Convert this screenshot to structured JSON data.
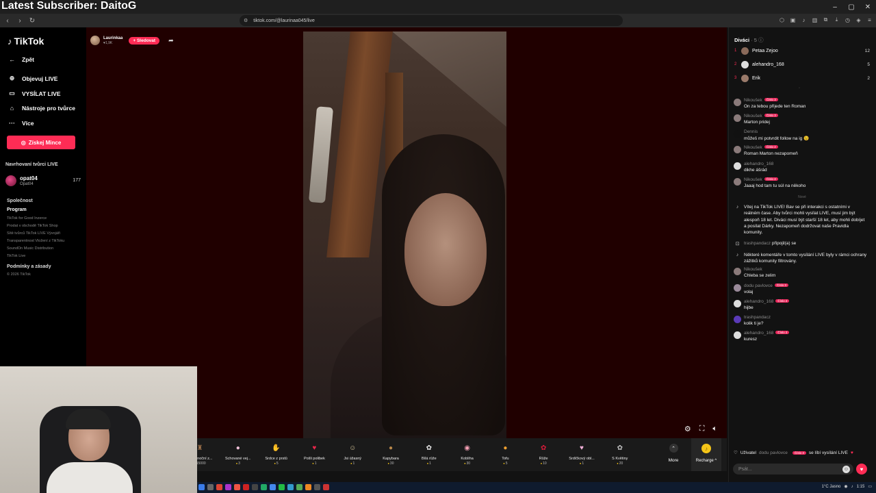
{
  "overlay": {
    "text": "Latest Subscriber: DaitoG"
  },
  "browser": {
    "url": "tiktok.com/@laurinaa045/live",
    "window_controls": [
      "–",
      "▢",
      "✕"
    ]
  },
  "sidebar": {
    "logo": "TikTok",
    "nav": [
      {
        "label": "Zpět",
        "icon": "arrow-left-icon",
        "glyph": "←"
      },
      {
        "label": "Objevuj LIVE",
        "icon": "compass-icon",
        "glyph": "⊕"
      },
      {
        "label": "VYSÍLAT LIVE",
        "icon": "camera-icon",
        "glyph": "▭"
      },
      {
        "label": "Nástroje pro tvůrce",
        "icon": "home-icon",
        "glyph": "⌂"
      },
      {
        "label": "Více",
        "icon": "more-icon",
        "glyph": "···"
      }
    ],
    "coins_button": "Získej Mince",
    "suggested_title": "Navrhovaní tvůrci LIVE",
    "suggested_creator": {
      "name": "opat04",
      "sub": "Opat04",
      "count": "177"
    },
    "company_title": "Společnost",
    "program_title": "Program",
    "links": [
      "TikTok for Good  Inzerce",
      "Prodat v obchodě TikTok Shop",
      "Sítě tvůrců TikTok LIVE  Vývojáři",
      "Transparentnost  Vložení z TikToku",
      "SoundOn Music Distribution",
      "TikTok Live"
    ],
    "terms_title": "Podmínky a zásady",
    "copyright": "© 2026 TikTok"
  },
  "stream": {
    "host_name": "Laurinkaa",
    "host_likes": "♥1,9K",
    "follow_label": "+ Sledovat"
  },
  "gifts": [
    {
      "name": "Velikonoční z...",
      "price": "15000",
      "glyph": "♜",
      "color": "#a0724a"
    },
    {
      "name": "Schované vej...",
      "price": "3",
      "glyph": "●",
      "color": "#f0c0d8"
    },
    {
      "name": "Srdce z prstů",
      "price": "5",
      "glyph": "✋",
      "color": "#f29a9a"
    },
    {
      "name": "Pošli polibek",
      "price": "1",
      "glyph": "♥",
      "color": "#e8264a"
    },
    {
      "name": "Jsi úžasný",
      "price": "1",
      "glyph": "☺",
      "color": "#d9c89a"
    },
    {
      "name": "Kapybara",
      "price": "30",
      "glyph": "●",
      "color": "#b8874a"
    },
    {
      "name": "Bílá růže",
      "price": "1",
      "glyph": "✿",
      "color": "#e8e8e8"
    },
    {
      "name": "Kobliha",
      "price": "30",
      "glyph": "◉",
      "color": "#f5a0b5"
    },
    {
      "name": "Tofu",
      "price": "5",
      "glyph": "●",
      "color": "#f0a030"
    },
    {
      "name": "Růže",
      "price": "10",
      "glyph": "✿",
      "color": "#d81b3a"
    },
    {
      "name": "Srdíčkový obl...",
      "price": "1",
      "glyph": "♥",
      "color": "#f0b0d8"
    },
    {
      "name": "S Květiny",
      "price": "20",
      "glyph": "✿",
      "color": "#c0c0c0"
    }
  ],
  "more_label": "More",
  "recharge_label": "Recharge ^",
  "chat": {
    "viewers_title": "Diváci",
    "viewers_count": "· 5",
    "top_viewers": [
      {
        "rank": "1",
        "name": "Petaa Zejoo",
        "score": "12",
        "color": "#8a6a5a"
      },
      {
        "rank": "2",
        "name": "alehandro_168",
        "score": "5",
        "color": "#dddddd"
      },
      {
        "rank": "3",
        "name": "Erik",
        "score": "2",
        "color": "#9a7a6a"
      }
    ],
    "messages": [
      {
        "user": "Nikoušek",
        "badge": "Číslo 3",
        "text": "On za tebou přijede ten Roman",
        "color": "#8a7a7a"
      },
      {
        "user": "Nikoušek",
        "badge": "Číslo 3",
        "text": "Marton pridej",
        "color": "#8a7a7a"
      },
      {
        "user": "Dennis",
        "badge": "",
        "text": "můžeš mi potvrdit follow na ig 😉",
        "color": "#111111"
      },
      {
        "user": "Nikoušek",
        "badge": "Číslo 2",
        "text": "Roman Marton nezapomeň",
        "color": "#8a7a7a"
      },
      {
        "user": "alehandro_168",
        "badge": "",
        "text": "dikhe ášrád",
        "color": "#dddddd"
      },
      {
        "user": "Nikoušek",
        "badge": "Číslo 2",
        "text": "Jaaaj hod tam tu súl na někoho",
        "color": "#8a7a7a"
      }
    ],
    "new_label": "Nové",
    "welcome": "Vítej na TikTok LIVE! Bav se při interakci s ostatními v reálném čase. Aby tvůrci mohli vysílat LIVE, musí jim být alespoň 18 let. Diváci musí být starší 18 let, aby mohli dobíjet a posílat Dárky. Nezapomeň dodržovat naše Pravidla komunity.",
    "joined_user": "trashpandacz",
    "joined_text": "připojil(a) se",
    "filter_note": "Některé komentáře v tomto vysílání LIVE byly v rámci ochrany zážitků komunity filtrovány.",
    "messages2": [
      {
        "user": "Nikoušek",
        "badge": "",
        "text": "Chleba se zelim",
        "color": "#8a7a7a"
      },
      {
        "user": "dodu pavlovce",
        "badge": "Číslo 3",
        "text": "volaj",
        "color": "#9a8a9a"
      },
      {
        "user": "alehandro_168",
        "badge": "Číslo 2",
        "text": "hijbe",
        "color": "#dddddd"
      },
      {
        "user": "trashpandacz",
        "badge": "",
        "text": "kolik ti je?",
        "color": "#5a3ab8"
      },
      {
        "user": "alehandro_168",
        "badge": "Číslo 2",
        "text": "kuresz",
        "color": "#dddddd"
      }
    ],
    "like_prefix": "Uživatel",
    "like_user": "dodu pavlovce",
    "like_badge": "Číslo 3",
    "like_suffix": "se líbí vysílání LIVE",
    "input_placeholder": "Psát..."
  },
  "taskbar": {
    "weather": "1°C  Jasno",
    "time": "1:15"
  }
}
